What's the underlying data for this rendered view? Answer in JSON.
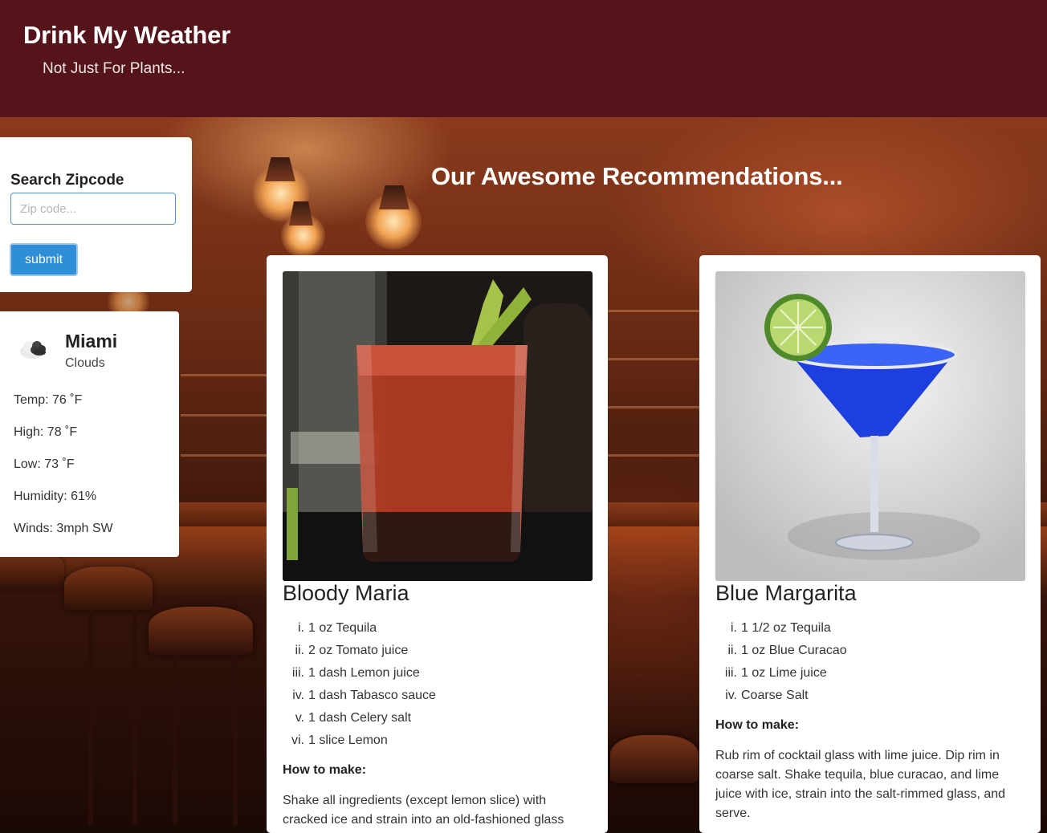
{
  "header": {
    "title": "Drink My Weather",
    "tagline": "Not Just For Plants..."
  },
  "search": {
    "label": "Search Zipcode",
    "placeholder": "Zip code...",
    "value": "",
    "submit_label": "submit"
  },
  "weather": {
    "icon": "clouds-icon",
    "city": "Miami",
    "condition": "Clouds",
    "temp": "Temp: 76 ˚F",
    "high": "High: 78 ˚F",
    "low": "Low: 73 ˚F",
    "humidity": "Humidity: 61%",
    "winds": "Winds: 3mph SW"
  },
  "recommendations": {
    "heading": "Our Awesome Recommendations...",
    "drinks": [
      {
        "name": "Bloody Maria",
        "ingredients": [
          {
            "num": "i.",
            "text": "1 oz Tequila"
          },
          {
            "num": "ii.",
            "text": "2 oz Tomato juice"
          },
          {
            "num": "iii.",
            "text": "1 dash Lemon juice"
          },
          {
            "num": "iv.",
            "text": "1 dash Tabasco sauce"
          },
          {
            "num": "v.",
            "text": "1 dash Celery salt"
          },
          {
            "num": "vi.",
            "text": "1 slice Lemon"
          }
        ],
        "howto_label": "How to make:",
        "howto": "Shake all ingredients (except lemon slice) with cracked ice and strain into an old-fashioned glass"
      },
      {
        "name": "Blue Margarita",
        "ingredients": [
          {
            "num": "i.",
            "text": "1 1/2 oz Tequila"
          },
          {
            "num": "ii.",
            "text": "1 oz Blue Curacao"
          },
          {
            "num": "iii.",
            "text": "1 oz Lime juice"
          },
          {
            "num": "iv.",
            "text": "Coarse Salt"
          }
        ],
        "howto_label": "How to make:",
        "howto": "Rub rim of cocktail glass with lime juice. Dip rim in coarse salt. Shake tequila, blue curacao, and lime juice with ice, strain into the salt-rimmed glass, and serve."
      }
    ]
  }
}
